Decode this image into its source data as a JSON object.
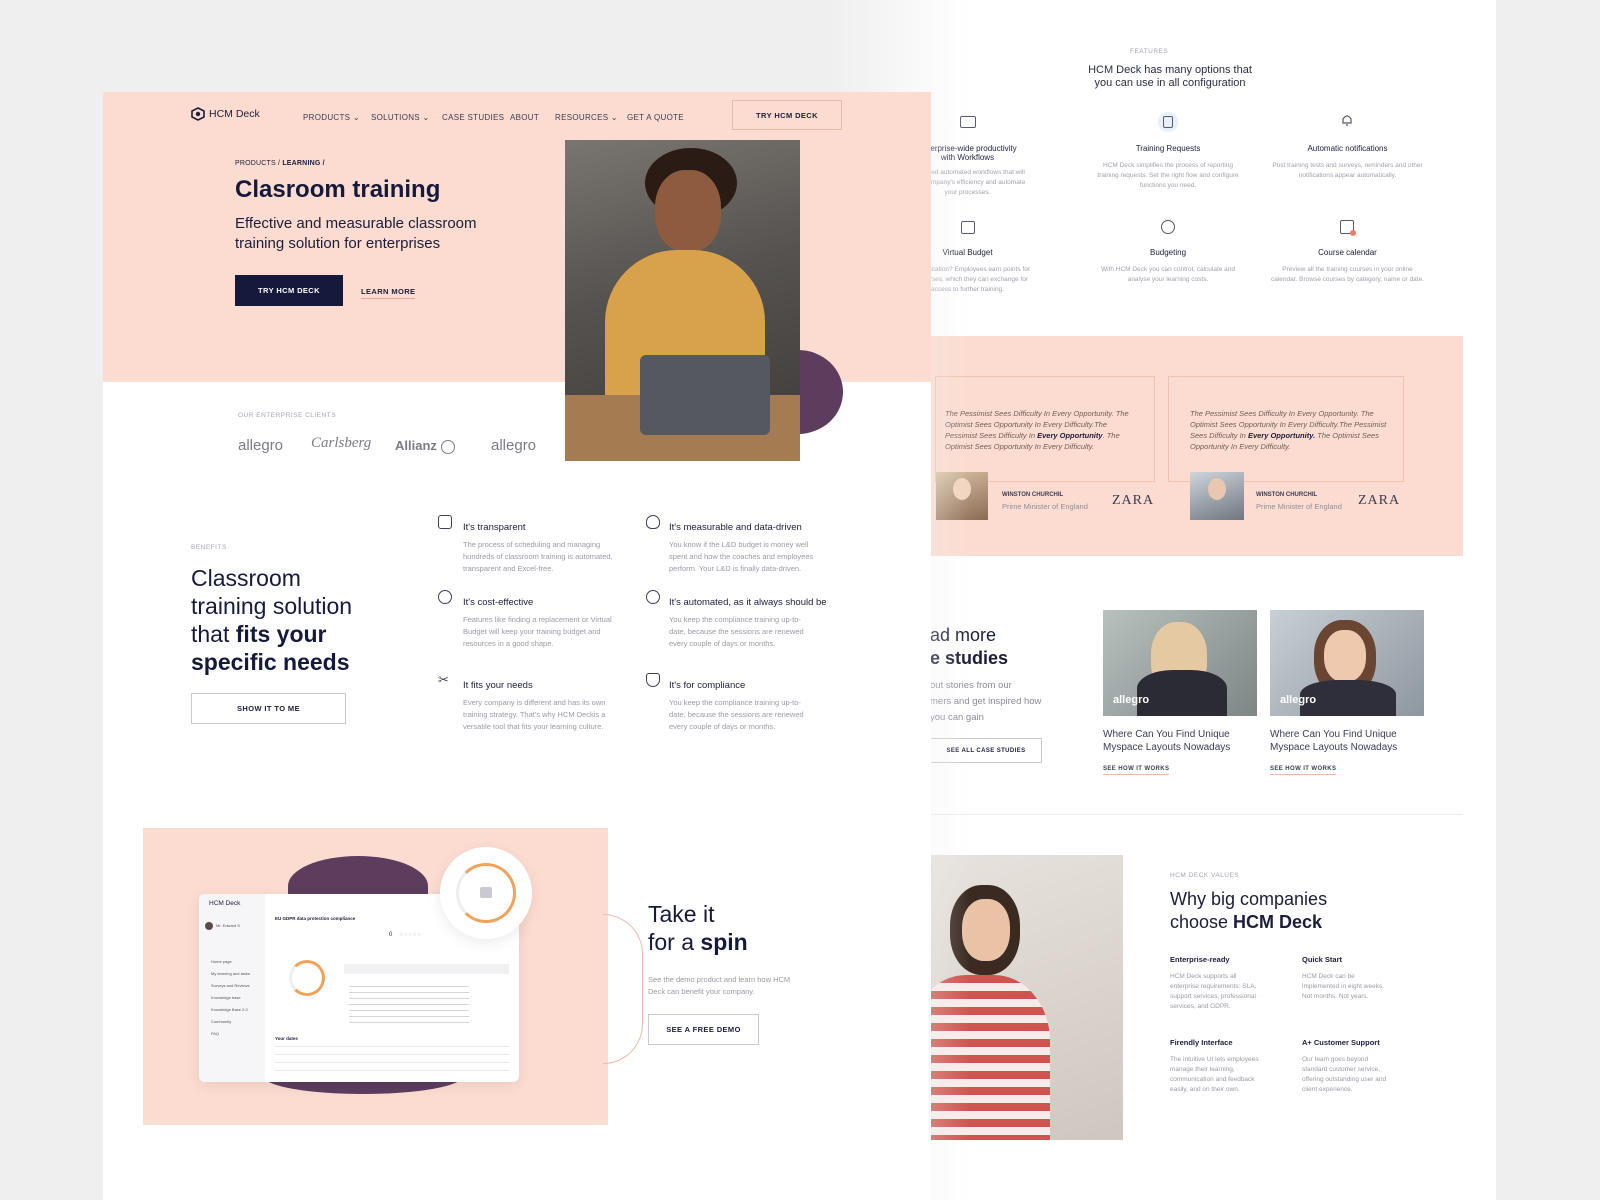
{
  "nav": {
    "brand": "HCM Deck",
    "products": "PRODUCTS",
    "solutions": "SOLUTIONS",
    "case_studies": "CASE STUDIES",
    "about": "ABOUT",
    "resources": "RESOURCES",
    "get_quote": "GET A QUOTE",
    "try_button": "TRY HCM DECK"
  },
  "hero": {
    "breadcrumb_a": "PRODUCTS /",
    "breadcrumb_b": "LEARNING /",
    "title": "Clasroom training",
    "subtitle_line1": "Effective and measurable classroom",
    "subtitle_line2": "training solution for enterprises",
    "primary_button": "TRY HCM DECK",
    "secondary_link": "LEARN MORE"
  },
  "clients": {
    "label": "OUR ENTERPRISE CLIENTS",
    "logos": [
      "allegro",
      "Carlsberg",
      "Allianz",
      "allegro"
    ]
  },
  "benefits": {
    "label": "BENEFITS",
    "heading_l1": "Classroom",
    "heading_l2": "training solution",
    "heading_l3a": "that ",
    "heading_l3b": "fits your",
    "heading_l4": "specific needs",
    "button": "SHOW IT TO ME",
    "items": [
      {
        "title": "It's transparent",
        "desc1": "The process of scheduling and managing",
        "desc2": "hundreds of classroom training is automated,",
        "desc3": "transparent and Excel-free."
      },
      {
        "title": "It's measurable and data-driven",
        "desc1": "You know if the L&D budget is money well",
        "desc2": "spent and how the coaches and employees",
        "desc3": "perform. Your L&D is finally data-driven."
      },
      {
        "title": "It's cost-effective",
        "desc1": "Features like finding a replacement or Virtual",
        "desc2": "Budget will keep your training budget and",
        "desc3": "resources in a good shape."
      },
      {
        "title": "It's automated, as it always should be",
        "desc1": "You keep the compliance training up-to-",
        "desc2": "date, because the sessions are renewed",
        "desc3": "every couple of days or months."
      },
      {
        "title": "It fits your needs",
        "desc1": "Every company is different and has its own",
        "desc2": "training strategy. That's why HCM Deckis a",
        "desc3": "versatile tool that fits your learning culture."
      },
      {
        "title": "It's for compliance",
        "desc1": "You keep the compliance training up-to-",
        "desc2": "date, because the sessions are renewed",
        "desc3": "every couple of days or months."
      }
    ]
  },
  "demo": {
    "heading_l1": "Take it",
    "heading_l2a": "for a ",
    "heading_l2b": "spin",
    "desc1": "See the demo product and learn how HCM",
    "desc2": "Deck can benefit your company.",
    "button": "SEE A FREE DEMO",
    "mock_brand": "HCM Deck",
    "mock_title": "EU GDPR data protection compliance",
    "mock_dates": "Your dates",
    "mock_user": "Mr. Edward S",
    "mock_count": "0",
    "mock_menu": [
      "Home page",
      "My learning and tasks",
      "Surveys and Reviews",
      "Knowledge base",
      "Knowledge Base 2.0",
      "Community",
      "FAQ"
    ]
  },
  "features": {
    "label": "FEATURES",
    "heading_l1": "HCM Deck has many options that",
    "heading_l2": "you can use in all configuration",
    "items": [
      {
        "title1": "Enterprise-wide productivity",
        "title2": "with Workflows",
        "d1": "advanced automated workflows that will",
        "d2": "your company's efficiency and automate",
        "d3": "your processes."
      },
      {
        "title1": "Training Requests",
        "title2": "",
        "d1": "HCM Deck simplifies the process of reporting",
        "d2": "training requests. Set the right flow and configure",
        "d3": "functions you need."
      },
      {
        "title1": "Automatic notifications",
        "title2": "",
        "d1": "Post training tests and surveys, reminders and other",
        "d2": "notifications appear automatically.",
        "d3": ""
      },
      {
        "title1": "Virtual Budget",
        "title2": "",
        "d1": "for gamification? Employees earn points for",
        "d2": "ited courses, which they can exchange for",
        "d3": "access to further training."
      },
      {
        "title1": "Budgeting",
        "title2": "",
        "d1": "With HCM Deck you can control, calculate and",
        "d2": "analyse your learning costs.",
        "d3": ""
      },
      {
        "title1": "Course calendar",
        "title2": "",
        "d1": "Preview all the training courses in your online",
        "d2": "calendar. Browse courses by category, name or date.",
        "d3": ""
      }
    ]
  },
  "testimonials": [
    {
      "q1": "The Pessimist Sees Difficulty In Every Opportunity. The",
      "q2": "Optimist Sees Opportunity In Every Difficulty.The",
      "q3a": "Pessimist Sees Difficulty In ",
      "q3b": "Every Opportunity",
      "q3c": ". The",
      "q4": "Optimist Sees Opportunity In Every Difficulty.",
      "name": "WINSTON CHURCHIL",
      "role": "Prime Minister of England",
      "brand": "ZARA"
    },
    {
      "q1": "The Pessimist Sees Difficulty In Every Opportunity. The",
      "q2": "Optimist Sees Opportunity In Every Difficulty.The Pessimist",
      "q3a": "Sees Difficulty In ",
      "q3b": "Every Opportunity.",
      "q3c": " The Optimist Sees",
      "q4": "Opportunity In Every Difficulty.",
      "name": "WINSTON CHURCHIL",
      "role": "Prime Minister of England",
      "brand": "ZARA"
    }
  ],
  "cases": {
    "heading_l1": "ad more",
    "heading_l2": "e studies",
    "desc1": "out stories from our",
    "desc2": "mers and get inspired how",
    "desc3": "you can gain",
    "button": "SEE ALL CASE STUDIES",
    "items": [
      {
        "badge": "allegro",
        "t1": "Where Can You Find Unique",
        "t2": "Myspace Layouts Nowadays",
        "link": "SEE HOW IT WORKS"
      },
      {
        "badge": "allegro",
        "t1": "Where Can You Find Unique",
        "t2": "Myspace Layouts Nowadays",
        "link": "SEE HOW IT WORKS"
      }
    ]
  },
  "values": {
    "label": "HCM DECK VALUES",
    "heading_l1": "Why big companies",
    "heading_l2a": "choose ",
    "heading_l2b": "HCM Deck",
    "items": [
      {
        "title": "Enterprise-ready",
        "d1": "HCM Deck supports all",
        "d2": "enterprise requirements: SLA,",
        "d3": "support services, professional",
        "d4": "services, and GDPR."
      },
      {
        "title": "Quick Start",
        "d1": "HCM Deck can be",
        "d2": "implemented in eight weeks.",
        "d3": "Not months. Not years.",
        "d4": ""
      },
      {
        "title": "Firendly Interface",
        "d1": "The intuitive UI lets employees",
        "d2": "manage their learning,",
        "d3": "communication and feedback",
        "d4": "easily, and on their own."
      },
      {
        "title": "A+ Customer Support",
        "d1": "Our team goes beyond",
        "d2": "standard customer service,",
        "d3": "offering outstanding user and",
        "d4": "client experience."
      }
    ]
  },
  "colors": {
    "navy": "#151a3c",
    "peach": "#fcdcd0",
    "plum": "#5c3d5e",
    "orange": "#f0a25a"
  }
}
